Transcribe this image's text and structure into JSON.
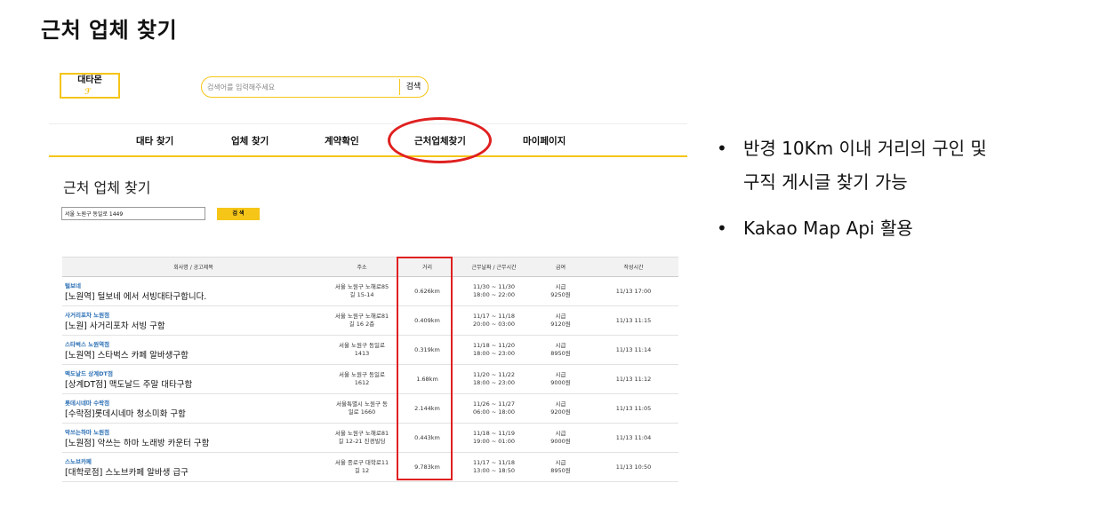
{
  "slide_title": "근처 업체 찾기",
  "app": {
    "logo_text": "대타몬",
    "logo_mark": "ℱ",
    "search": {
      "placeholder": "검색어를 입력해주세요",
      "button": "검색"
    },
    "nav": [
      "대타 찾기",
      "업체 찾기",
      "계약확인",
      "근처업체찾기",
      "마이페이지"
    ],
    "section_title": "근처 업체 찾기",
    "address_input": "서울 노원구 동일로 1449",
    "address_button": "검 색",
    "table": {
      "headers": [
        "회사명 / 공고제목",
        "주소",
        "거리",
        "근무날짜 / 근무시간",
        "급여",
        "작성시간"
      ],
      "rows": [
        {
          "company": "털보네",
          "title": "[노원역] 털보네 에서 서빙대타구합니다.",
          "addr1": "서울 노원구 노해로85",
          "addr2": "길 15-14",
          "distance": "0.626km",
          "date": "11/30 ~ 11/30",
          "time": "18:00 ~ 22:00",
          "pay_type": "시급",
          "pay": "9250원",
          "written": "11/13 17:00"
        },
        {
          "company": "사거리포차 노원점",
          "title": "[노원] 사거리포차 서빙 구함",
          "addr1": "서울 노원구 노해로81",
          "addr2": "길 16 2층",
          "distance": "0.409km",
          "date": "11/17 ~ 11/18",
          "time": "20:00 ~ 03:00",
          "pay_type": "시급",
          "pay": "9120원",
          "written": "11/13 11:15"
        },
        {
          "company": "스타벅스 노원역점",
          "title": "[노원역] 스타벅스 카페 알바생구함",
          "addr1": "서울 노원구 동일로",
          "addr2": "1413",
          "distance": "0.319km",
          "date": "11/18 ~ 11/20",
          "time": "18:00 ~ 23:00",
          "pay_type": "시급",
          "pay": "8950원",
          "written": "11/13 11:14"
        },
        {
          "company": "맥도날드 상계DT점",
          "title": "[상계DT점] 맥도날드 주말 대타구함",
          "addr1": "서울 노원구 동일로",
          "addr2": "1612",
          "distance": "1.68km",
          "date": "11/20 ~ 11/22",
          "time": "18:00 ~ 23:00",
          "pay_type": "시급",
          "pay": "9000원",
          "written": "11/13 11:12"
        },
        {
          "company": "롯데시네마 수락점",
          "title": "[수락점]롯데시네마 청소미화 구함",
          "addr1": "서울특별시 노원구 동",
          "addr2": "일로 1660",
          "distance": "2.144km",
          "date": "11/26 ~ 11/27",
          "time": "06:00 ~ 18:00",
          "pay_type": "시급",
          "pay": "9200원",
          "written": "11/13 11:05"
        },
        {
          "company": "악쓰는하마 노원점",
          "title": "[노원점] 악쓰는 하마 노래방 카운터 구함",
          "addr1": "서울 노원구 노해로81",
          "addr2": "길 12-21 진경빌딩",
          "distance": "0.443km",
          "date": "11/18 ~ 11/19",
          "time": "19:00 ~ 01:00",
          "pay_type": "시급",
          "pay": "9000원",
          "written": "11/13 11:04"
        },
        {
          "company": "스노브카페",
          "title": "[대학로점] 스노브카페 알바생 급구",
          "addr1": "서울 종로구 대학로11",
          "addr2": "길 12",
          "distance": "9.783km",
          "date": "11/17 ~ 11/18",
          "time": "13:00 ~ 18:50",
          "pay_type": "시급",
          "pay": "8950원",
          "written": "11/13 10:50"
        }
      ]
    }
  },
  "bullets": [
    {
      "symbol": "•",
      "lines": [
        "반경 10Km 이내 거리의 구인 및",
        "구직 게시글 찾기 가능"
      ]
    },
    {
      "symbol": "•",
      "lines": [
        "Kakao Map Api 활용"
      ]
    }
  ],
  "colors": {
    "accent": "#f5c518",
    "highlight": "#e02020",
    "company_link": "#2b6fb5"
  }
}
